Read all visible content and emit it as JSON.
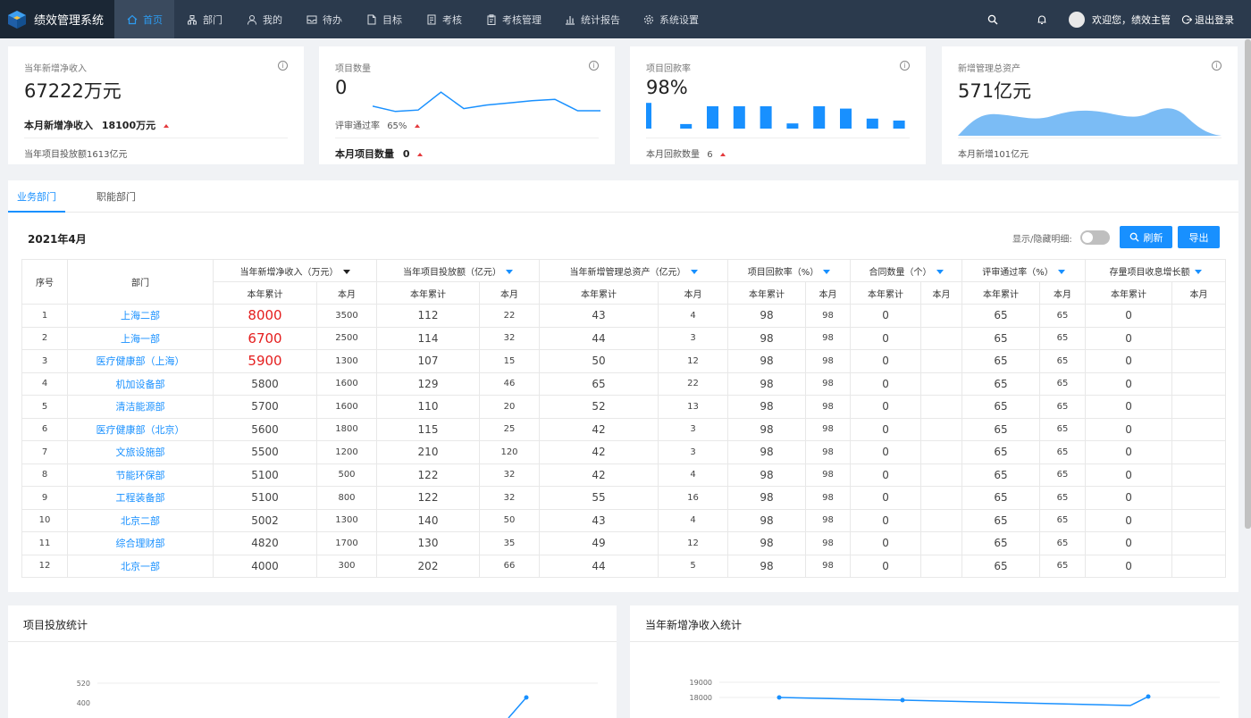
{
  "app": {
    "title": "绩效管理系统"
  },
  "nav": {
    "items": [
      {
        "label": "首页",
        "icon": "home-icon",
        "active": true
      },
      {
        "label": "部门",
        "icon": "org-icon"
      },
      {
        "label": "我的",
        "icon": "user-icon"
      },
      {
        "label": "待办",
        "icon": "inbox-icon"
      },
      {
        "label": "目标",
        "icon": "file-icon"
      },
      {
        "label": "考核",
        "icon": "checklist-icon"
      },
      {
        "label": "考核管理",
        "icon": "clipboard-icon"
      },
      {
        "label": "统计报告",
        "icon": "bar-chart-icon"
      },
      {
        "label": "系统设置",
        "icon": "gear-icon"
      }
    ]
  },
  "header": {
    "greeting": "欢迎您，绩效主管",
    "logout": "退出登录"
  },
  "cards": [
    {
      "label": "当年新增净收入",
      "value": "67222万元",
      "sub1_label": "本月新增净收入",
      "sub1_value": "18100万元",
      "footer": "当年项目投放额1613亿元"
    },
    {
      "label": "项目数量",
      "value": "0",
      "sub1_label": "评审通过率",
      "sub1_value": "65%",
      "footer_label": "本月项目数量",
      "footer_value": "0"
    },
    {
      "label": "项目回款率",
      "value": "98%",
      "footer_label": "本月回款数量",
      "footer_value": "6"
    },
    {
      "label": "新增管理总资产",
      "value": "571亿元",
      "footer": "本月新增101亿元"
    }
  ],
  "card_charts": {
    "line": [
      0.33,
      0.18,
      0.22,
      0.72,
      0.26,
      0.36,
      0.42,
      0.48,
      0.52,
      0.2,
      0.2
    ],
    "bars": [
      0.9,
      0.16,
      0.78,
      0.78,
      0.78,
      0.18,
      0.78,
      0.7,
      0.35,
      0.28
    ],
    "bar_color": "#1890ff",
    "area_color": "#7bbcf5"
  },
  "tabs": [
    "业务部门",
    "职能部门"
  ],
  "period": "2021年4月",
  "toggle_label": "显示/隐藏明细:",
  "buttons": {
    "refresh": "刷新",
    "export": "导出"
  },
  "table": {
    "seq_header": "序号",
    "dept_header": "部门",
    "groups": [
      "当年新增净收入（万元）",
      "当年项目投放额（亿元）",
      "当年新增管理总资产（亿元）",
      "项目回款率（%）",
      "合同数量（个）",
      "评审通过率（%）",
      "存量项目收息增长额"
    ],
    "sub_headers": [
      "本年累计",
      "本月"
    ],
    "rows": [
      {
        "seq": "1",
        "dept": "上海二部",
        "v": [
          "8000",
          "3500",
          "112",
          "22",
          "43",
          "4",
          "98",
          "98",
          "0",
          "",
          "65",
          "65",
          "0",
          ""
        ],
        "red": true
      },
      {
        "seq": "2",
        "dept": "上海一部",
        "v": [
          "6700",
          "2500",
          "114",
          "32",
          "44",
          "3",
          "98",
          "98",
          "0",
          "",
          "65",
          "65",
          "0",
          ""
        ],
        "red": true
      },
      {
        "seq": "3",
        "dept": "医疗健康部（上海）",
        "v": [
          "5900",
          "1300",
          "107",
          "15",
          "50",
          "12",
          "98",
          "98",
          "0",
          "",
          "65",
          "65",
          "0",
          ""
        ],
        "red": true
      },
      {
        "seq": "4",
        "dept": "机加设备部",
        "v": [
          "5800",
          "1600",
          "129",
          "46",
          "65",
          "22",
          "98",
          "98",
          "0",
          "",
          "65",
          "65",
          "0",
          ""
        ]
      },
      {
        "seq": "5",
        "dept": "清洁能源部",
        "v": [
          "5700",
          "1600",
          "110",
          "20",
          "52",
          "13",
          "98",
          "98",
          "0",
          "",
          "65",
          "65",
          "0",
          ""
        ]
      },
      {
        "seq": "6",
        "dept": "医疗健康部（北京）",
        "v": [
          "5600",
          "1800",
          "115",
          "25",
          "42",
          "3",
          "98",
          "98",
          "0",
          "",
          "65",
          "65",
          "0",
          ""
        ]
      },
      {
        "seq": "7",
        "dept": "文旅设施部",
        "v": [
          "5500",
          "1200",
          "210",
          "120",
          "42",
          "3",
          "98",
          "98",
          "0",
          "",
          "65",
          "65",
          "0",
          ""
        ]
      },
      {
        "seq": "8",
        "dept": "节能环保部",
        "v": [
          "5100",
          "500",
          "122",
          "32",
          "42",
          "4",
          "98",
          "98",
          "0",
          "",
          "65",
          "65",
          "0",
          ""
        ]
      },
      {
        "seq": "9",
        "dept": "工程装备部",
        "v": [
          "5100",
          "800",
          "122",
          "32",
          "55",
          "16",
          "98",
          "98",
          "0",
          "",
          "65",
          "65",
          "0",
          ""
        ]
      },
      {
        "seq": "10",
        "dept": "北京二部",
        "v": [
          "5002",
          "1300",
          "140",
          "50",
          "43",
          "4",
          "98",
          "98",
          "0",
          "",
          "65",
          "65",
          "0",
          ""
        ]
      },
      {
        "seq": "11",
        "dept": "综合理财部",
        "v": [
          "4820",
          "1700",
          "130",
          "35",
          "49",
          "12",
          "98",
          "98",
          "0",
          "",
          "65",
          "65",
          "0",
          ""
        ]
      },
      {
        "seq": "12",
        "dept": "北京一部",
        "v": [
          "4000",
          "300",
          "202",
          "66",
          "44",
          "5",
          "98",
          "98",
          "0",
          "",
          "65",
          "65",
          "0",
          ""
        ]
      }
    ]
  },
  "bottom": {
    "left_title": "项目投放统计",
    "right_title": "当年新增净收入统计"
  },
  "chart_data": [
    {
      "type": "line",
      "title": "项目投放统计",
      "y_ticks": [
        "520"
      ],
      "points": [
        0.55,
        1.0
      ]
    },
    {
      "type": "line",
      "title": "当年新增净收入统计",
      "y_ticks": [
        "19000",
        "18000"
      ],
      "values": [
        18000,
        17900,
        18100
      ]
    }
  ]
}
